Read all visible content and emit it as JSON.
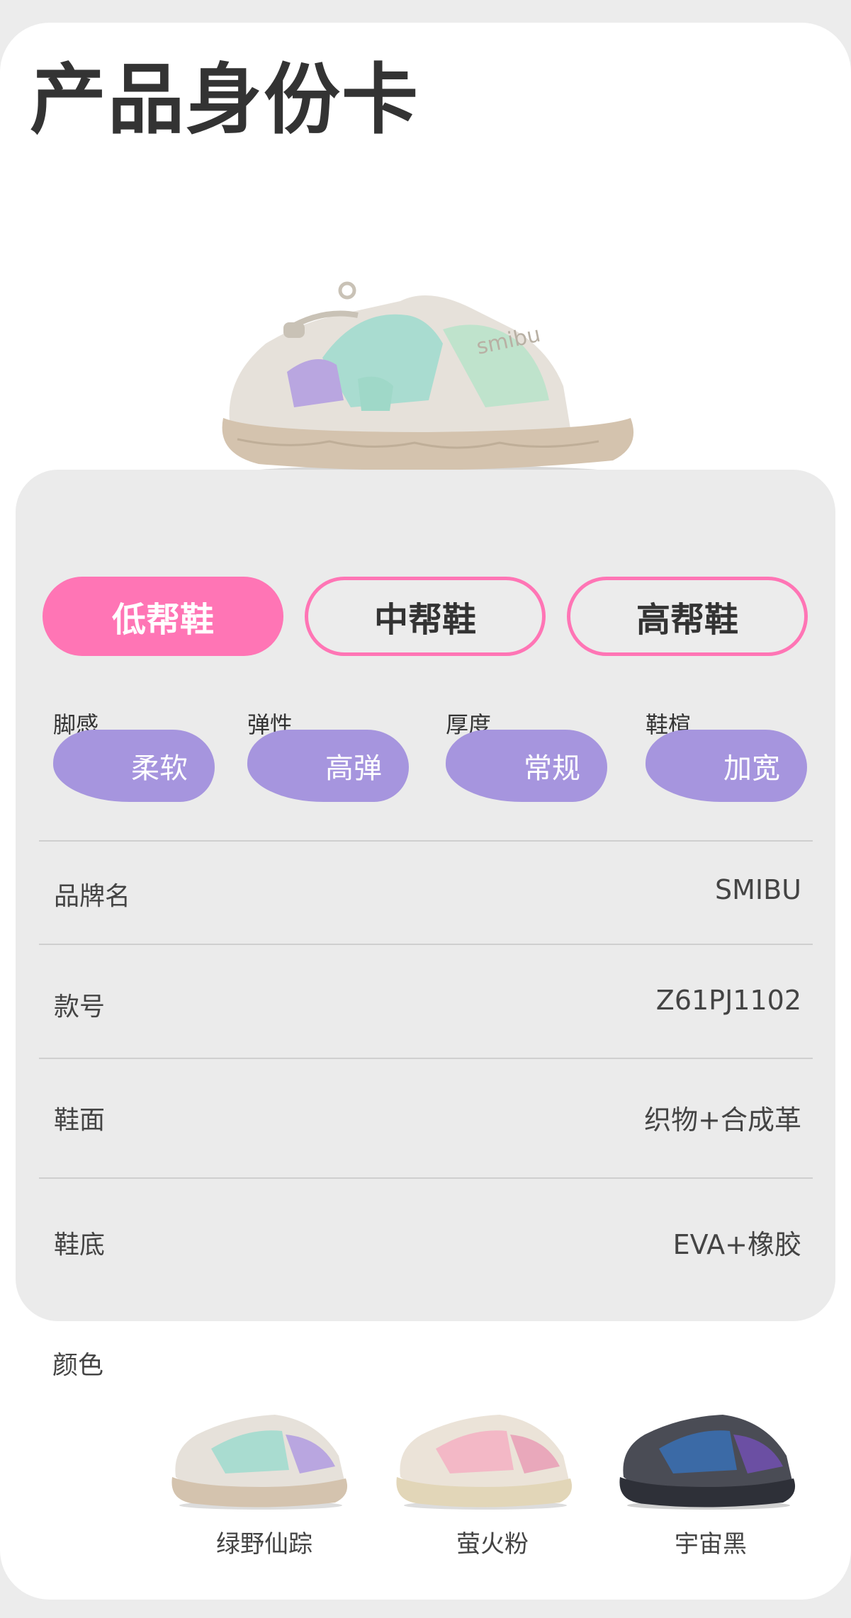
{
  "title": "产品身份卡",
  "shoe_types": [
    {
      "label": "低帮鞋"
    },
    {
      "label": "中帮鞋"
    },
    {
      "label": "高帮鞋"
    }
  ],
  "attributes": [
    {
      "label": "脚感",
      "value": "柔软"
    },
    {
      "label": "弹性",
      "value": "高弹"
    },
    {
      "label": "厚度",
      "value": "常规"
    },
    {
      "label": "鞋楦",
      "value": "加宽"
    }
  ],
  "specs": [
    {
      "label": "品牌名",
      "value": "SMIBU"
    },
    {
      "label": "款号",
      "value": "Z61PJ1102"
    },
    {
      "label": "鞋面",
      "value": "织物+合成革"
    },
    {
      "label": "鞋底",
      "value": "EVA+橡胶"
    }
  ],
  "colors": {
    "label": "颜色",
    "options": [
      {
        "name": "绿野仙踪"
      },
      {
        "name": "萤火粉"
      },
      {
        "name": "宇宙黑"
      }
    ]
  }
}
